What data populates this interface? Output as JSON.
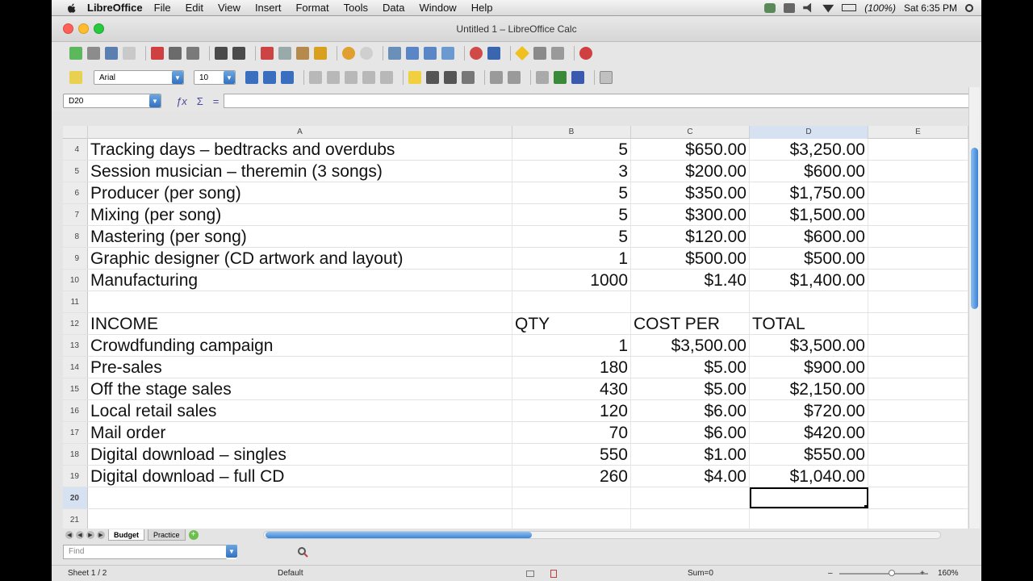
{
  "menubar": {
    "app_name": "LibreOffice",
    "items": [
      "File",
      "Edit",
      "View",
      "Insert",
      "Format",
      "Tools",
      "Data",
      "Window",
      "Help"
    ],
    "battery": "(100%)",
    "clock": "Sat 6:35 PM"
  },
  "window": {
    "title": "Untitled 1 – LibreOffice Calc"
  },
  "formatting": {
    "font_name": "Arial",
    "font_size": "10"
  },
  "formula_bar": {
    "name_box": "D20",
    "formula": ""
  },
  "columns": [
    {
      "letter": "A",
      "active": false
    },
    {
      "letter": "B",
      "active": false
    },
    {
      "letter": "C",
      "active": false
    },
    {
      "letter": "D",
      "active": true
    },
    {
      "letter": "E",
      "active": false
    }
  ],
  "rows": [
    {
      "n": "4",
      "a": "Tracking days – bedtracks and overdubs",
      "b": "5",
      "c": "$650.00",
      "d": "$3,250.00"
    },
    {
      "n": "5",
      "a": "Session musician – theremin (3 songs)",
      "b": "3",
      "c": "$200.00",
      "d": "$600.00"
    },
    {
      "n": "6",
      "a": "Producer (per song)",
      "b": "5",
      "c": "$350.00",
      "d": "$1,750.00"
    },
    {
      "n": "7",
      "a": "Mixing (per song)",
      "b": "5",
      "c": "$300.00",
      "d": "$1,500.00"
    },
    {
      "n": "8",
      "a": "Mastering (per song)",
      "b": "5",
      "c": "$120.00",
      "d": "$600.00"
    },
    {
      "n": "9",
      "a": "Graphic designer (CD artwork and layout)",
      "b": "1",
      "c": "$500.00",
      "d": "$500.00"
    },
    {
      "n": "10",
      "a": "Manufacturing",
      "b": "1000",
      "c": "$1.40",
      "d": "$1,400.00"
    },
    {
      "n": "11",
      "a": "",
      "b": "",
      "c": "",
      "d": ""
    },
    {
      "n": "12",
      "a": "INCOME",
      "b": "QTY",
      "c": "COST PER",
      "d": "TOTAL",
      "header": true
    },
    {
      "n": "13",
      "a": "Crowdfunding campaign",
      "b": "1",
      "c": "$3,500.00",
      "d": "$3,500.00"
    },
    {
      "n": "14",
      "a": "Pre-sales",
      "b": "180",
      "c": "$5.00",
      "d": "$900.00"
    },
    {
      "n": "15",
      "a": "Off the stage sales",
      "b": "430",
      "c": "$5.00",
      "d": "$2,150.00"
    },
    {
      "n": "16",
      "a": "Local retail sales",
      "b": "120",
      "c": "$6.00",
      "d": "$720.00"
    },
    {
      "n": "17",
      "a": "Mail order",
      "b": "70",
      "c": "$6.00",
      "d": "$420.00"
    },
    {
      "n": "18",
      "a": "Digital download – singles",
      "b": "550",
      "c": "$1.00",
      "d": "$550.00"
    },
    {
      "n": "19",
      "a": "Digital download – full CD",
      "b": "260",
      "c": "$4.00",
      "d": "$1,040.00"
    },
    {
      "n": "20",
      "a": "",
      "b": "",
      "c": "",
      "d": "",
      "selected": true
    },
    {
      "n": "21",
      "a": "",
      "b": "",
      "c": "",
      "d": ""
    }
  ],
  "sheets": [
    {
      "name": "Budget",
      "active": true
    },
    {
      "name": "Practice",
      "active": false
    }
  ],
  "find": {
    "placeholder": "Find"
  },
  "status": {
    "sheet": "Sheet 1 / 2",
    "style": "Default",
    "sum": "Sum=0",
    "zoom": "160%",
    "zoom_level": 0.55
  },
  "colors": {
    "selection_header": "#d6e2f2",
    "scroll_accent": "#3b82d6"
  }
}
